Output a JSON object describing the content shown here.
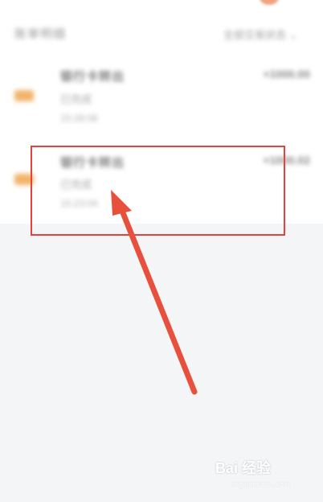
{
  "header": {
    "title": "账单明细",
    "filter": "全部交易状态"
  },
  "items": [
    {
      "title": "银行卡转出",
      "subtitle": "已完成",
      "time": "15:28:08",
      "amount": "+1000.00"
    },
    {
      "title": "银行卡转出",
      "subtitle": "已完成",
      "time": "15:23:04",
      "amount": "+1000.02"
    }
  ],
  "annotation": {
    "box_color": "#e8403c",
    "arrow_color": "#e8503e"
  },
  "watermark": {
    "brand": "Bai 经验",
    "url": "jingyan.baidu.com"
  }
}
